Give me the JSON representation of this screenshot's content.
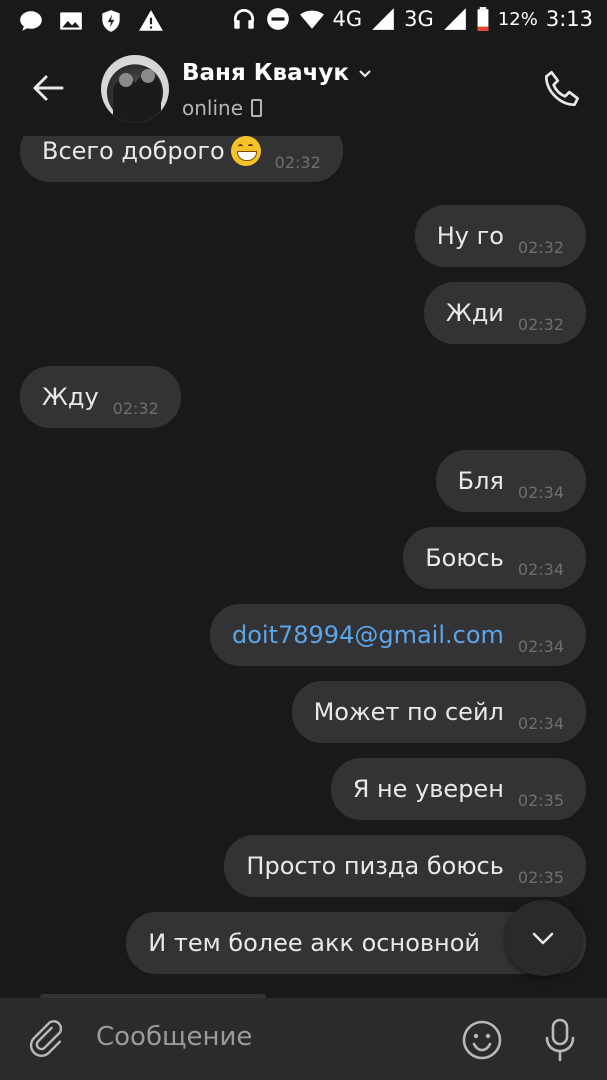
{
  "status_bar": {
    "network_4g": "4G",
    "network_3g": "3G",
    "battery": "12%",
    "time": "3:13"
  },
  "header": {
    "contact_name": "Ваня Квачук",
    "presence": "online"
  },
  "messages": [
    {
      "direction": "in",
      "text": "Всего доброго",
      "emoji": "grinning-face",
      "time": "02:32"
    },
    {
      "direction": "out",
      "text": "Ну го",
      "time": "02:32"
    },
    {
      "direction": "out",
      "text": "Жди",
      "time": "02:32"
    },
    {
      "direction": "in",
      "text": "Жду",
      "time": "02:32"
    },
    {
      "direction": "out",
      "text": "Бля",
      "time": "02:34"
    },
    {
      "direction": "out",
      "text": "Боюсь",
      "time": "02:34"
    },
    {
      "direction": "out",
      "text": "doit78994@gmail.com",
      "time": "02:34",
      "is_link": true
    },
    {
      "direction": "out",
      "text": "Может по сейл",
      "time": "02:34"
    },
    {
      "direction": "out",
      "text": "Я не уверен",
      "time": "02:35"
    },
    {
      "direction": "out",
      "text": "Просто пизда боюсь",
      "time": "02:35"
    },
    {
      "direction": "out",
      "text": "И тем более акк основной",
      "time": ""
    }
  ],
  "composer": {
    "placeholder": "Сообщение"
  },
  "colors": {
    "background": "#19191a",
    "bubble": "#333335",
    "link": "#5aa6e8",
    "composer": "#2b2b2d"
  }
}
